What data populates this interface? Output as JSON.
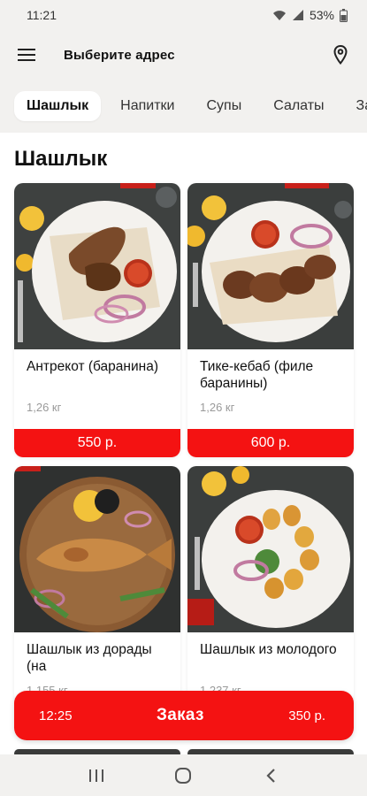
{
  "status_bar": {
    "time": "11:21",
    "battery": "53%"
  },
  "header": {
    "title": "Выберите адрес",
    "menu_icon": "hamburger-menu-icon",
    "location_icon": "map-pin-icon"
  },
  "tabs": [
    {
      "label": "Шашлык",
      "active": true
    },
    {
      "label": "Напитки",
      "active": false
    },
    {
      "label": "Супы",
      "active": false
    },
    {
      "label": "Салаты",
      "active": false
    },
    {
      "label": "За",
      "active": false
    }
  ],
  "section": {
    "title": "Шашлык"
  },
  "products": [
    {
      "name": "Антрекот (баранина)",
      "weight": "1,26 кг",
      "price": "550 р."
    },
    {
      "name": "Тике-кебаб (филе баранины)",
      "weight": "1,26 кг",
      "price": "600 р."
    },
    {
      "name": "Шашлык из дорады (на",
      "weight": "1,155 кг"
    },
    {
      "name": "Шашлык из молодого",
      "weight": "1,237 кг"
    }
  ],
  "order_bar": {
    "time": "12:25",
    "label": "Заказ",
    "sum": "350 р."
  },
  "colors": {
    "accent": "#f41212",
    "header_bg": "#f2f1ef"
  }
}
